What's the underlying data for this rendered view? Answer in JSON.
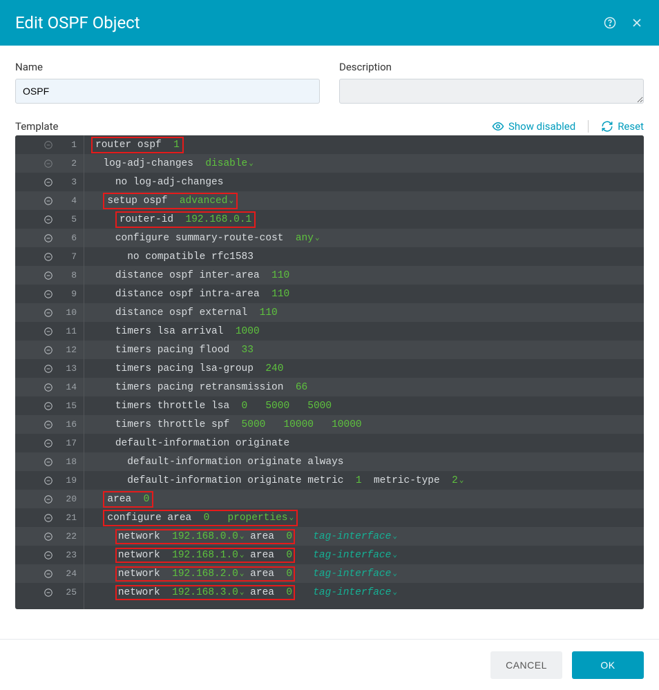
{
  "header": {
    "title": "Edit OSPF Object"
  },
  "form": {
    "name_label": "Name",
    "name_value": "OSPF",
    "desc_label": "Description",
    "desc_value": ""
  },
  "toolbar": {
    "template_label": "Template",
    "show_disabled": "Show disabled",
    "reset": "Reset"
  },
  "lines": [
    {
      "n": 1,
      "dim": true,
      "box": true,
      "indent": "",
      "segs": [
        {
          "t": "router ospf  ",
          "c": ""
        },
        {
          "t": "1",
          "c": "kw-green"
        }
      ]
    },
    {
      "n": 2,
      "dim": true,
      "box": false,
      "indent": "  ",
      "segs": [
        {
          "t": "log-adj-changes  ",
          "c": ""
        },
        {
          "t": "disable",
          "c": "kw-green",
          "chev": true
        }
      ]
    },
    {
      "n": 3,
      "dim": false,
      "box": false,
      "indent": "    ",
      "segs": [
        {
          "t": "no log-adj-changes",
          "c": ""
        }
      ]
    },
    {
      "n": 4,
      "dim": false,
      "box": true,
      "indent": "  ",
      "segs": [
        {
          "t": "setup ospf  ",
          "c": ""
        },
        {
          "t": "advanced",
          "c": "kw-green",
          "chev": true
        }
      ]
    },
    {
      "n": 5,
      "dim": false,
      "box": true,
      "indent": "    ",
      "segs": [
        {
          "t": "router-id  ",
          "c": ""
        },
        {
          "t": "192.168.0.1",
          "c": "kw-green"
        }
      ]
    },
    {
      "n": 6,
      "dim": false,
      "box": false,
      "indent": "    ",
      "segs": [
        {
          "t": "configure summary-route-cost  ",
          "c": ""
        },
        {
          "t": "any",
          "c": "kw-green",
          "chev": true
        }
      ]
    },
    {
      "n": 7,
      "dim": false,
      "box": false,
      "indent": "      ",
      "segs": [
        {
          "t": "no compatible rfc1583",
          "c": ""
        }
      ]
    },
    {
      "n": 8,
      "dim": false,
      "box": false,
      "indent": "    ",
      "segs": [
        {
          "t": "distance ospf inter-area  ",
          "c": ""
        },
        {
          "t": "110",
          "c": "kw-green"
        }
      ]
    },
    {
      "n": 9,
      "dim": false,
      "box": false,
      "indent": "    ",
      "segs": [
        {
          "t": "distance ospf intra-area  ",
          "c": ""
        },
        {
          "t": "110",
          "c": "kw-green"
        }
      ]
    },
    {
      "n": 10,
      "dim": false,
      "box": false,
      "indent": "    ",
      "segs": [
        {
          "t": "distance ospf external  ",
          "c": ""
        },
        {
          "t": "110",
          "c": "kw-green"
        }
      ]
    },
    {
      "n": 11,
      "dim": false,
      "box": false,
      "indent": "    ",
      "segs": [
        {
          "t": "timers lsa arrival  ",
          "c": ""
        },
        {
          "t": "1000",
          "c": "kw-green"
        }
      ]
    },
    {
      "n": 12,
      "dim": false,
      "box": false,
      "indent": "    ",
      "segs": [
        {
          "t": "timers pacing flood  ",
          "c": ""
        },
        {
          "t": "33",
          "c": "kw-green"
        }
      ]
    },
    {
      "n": 13,
      "dim": false,
      "box": false,
      "indent": "    ",
      "segs": [
        {
          "t": "timers pacing lsa-group  ",
          "c": ""
        },
        {
          "t": "240",
          "c": "kw-green"
        }
      ]
    },
    {
      "n": 14,
      "dim": false,
      "box": false,
      "indent": "    ",
      "segs": [
        {
          "t": "timers pacing retransmission  ",
          "c": ""
        },
        {
          "t": "66",
          "c": "kw-green"
        }
      ]
    },
    {
      "n": 15,
      "dim": false,
      "box": false,
      "indent": "    ",
      "segs": [
        {
          "t": "timers throttle lsa  ",
          "c": ""
        },
        {
          "t": "0",
          "c": "kw-green"
        },
        {
          "t": "   ",
          "c": ""
        },
        {
          "t": "5000",
          "c": "kw-green"
        },
        {
          "t": "   ",
          "c": ""
        },
        {
          "t": "5000",
          "c": "kw-green"
        }
      ]
    },
    {
      "n": 16,
      "dim": false,
      "box": false,
      "indent": "    ",
      "segs": [
        {
          "t": "timers throttle spf  ",
          "c": ""
        },
        {
          "t": "5000",
          "c": "kw-green"
        },
        {
          "t": "   ",
          "c": ""
        },
        {
          "t": "10000",
          "c": "kw-green"
        },
        {
          "t": "   ",
          "c": ""
        },
        {
          "t": "10000",
          "c": "kw-green"
        }
      ]
    },
    {
      "n": 17,
      "dim": false,
      "box": false,
      "indent": "    ",
      "segs": [
        {
          "t": "default-information originate",
          "c": ""
        }
      ]
    },
    {
      "n": 18,
      "dim": false,
      "box": false,
      "indent": "      ",
      "segs": [
        {
          "t": "default-information originate always",
          "c": ""
        }
      ]
    },
    {
      "n": 19,
      "dim": false,
      "box": false,
      "indent": "      ",
      "segs": [
        {
          "t": "default-information originate metric  ",
          "c": ""
        },
        {
          "t": "1",
          "c": "kw-green"
        },
        {
          "t": "  metric-type  ",
          "c": ""
        },
        {
          "t": "2",
          "c": "kw-green",
          "chev": true
        }
      ]
    },
    {
      "n": 20,
      "dim": false,
      "box": true,
      "indent": "  ",
      "segs": [
        {
          "t": "area  ",
          "c": ""
        },
        {
          "t": "0",
          "c": "kw-green"
        }
      ]
    },
    {
      "n": 21,
      "dim": false,
      "box": true,
      "indent": "  ",
      "segs": [
        {
          "t": "configure area  ",
          "c": ""
        },
        {
          "t": "0",
          "c": "kw-green"
        },
        {
          "t": "   ",
          "c": ""
        },
        {
          "t": "properties",
          "c": "kw-green",
          "chev": true
        }
      ]
    },
    {
      "n": 22,
      "dim": false,
      "box_inner": true,
      "indent": "    ",
      "segs": [
        {
          "t": "network  ",
          "c": ""
        },
        {
          "t": "192.168.0.0",
          "c": "kw-green",
          "chev": true
        },
        {
          "t": " area  ",
          "c": ""
        },
        {
          "t": "0",
          "c": "kw-green"
        }
      ],
      "tail": "tag-interface"
    },
    {
      "n": 23,
      "dim": false,
      "box_inner": true,
      "indent": "    ",
      "segs": [
        {
          "t": "network  ",
          "c": ""
        },
        {
          "t": "192.168.1.0",
          "c": "kw-green",
          "chev": true
        },
        {
          "t": " area  ",
          "c": ""
        },
        {
          "t": "0",
          "c": "kw-green"
        }
      ],
      "tail": "tag-interface"
    },
    {
      "n": 24,
      "dim": false,
      "box_inner": true,
      "indent": "    ",
      "segs": [
        {
          "t": "network  ",
          "c": ""
        },
        {
          "t": "192.168.2.0",
          "c": "kw-green",
          "chev": true
        },
        {
          "t": " area  ",
          "c": ""
        },
        {
          "t": "0",
          "c": "kw-green"
        }
      ],
      "tail": "tag-interface"
    },
    {
      "n": 25,
      "dim": false,
      "box_inner": true,
      "indent": "    ",
      "segs": [
        {
          "t": "network  ",
          "c": ""
        },
        {
          "t": "192.168.3.0",
          "c": "kw-green",
          "chev": true
        },
        {
          "t": " area  ",
          "c": ""
        },
        {
          "t": "0",
          "c": "kw-green"
        }
      ],
      "tail": "tag-interface"
    }
  ],
  "footer": {
    "cancel": "CANCEL",
    "ok": "OK"
  }
}
